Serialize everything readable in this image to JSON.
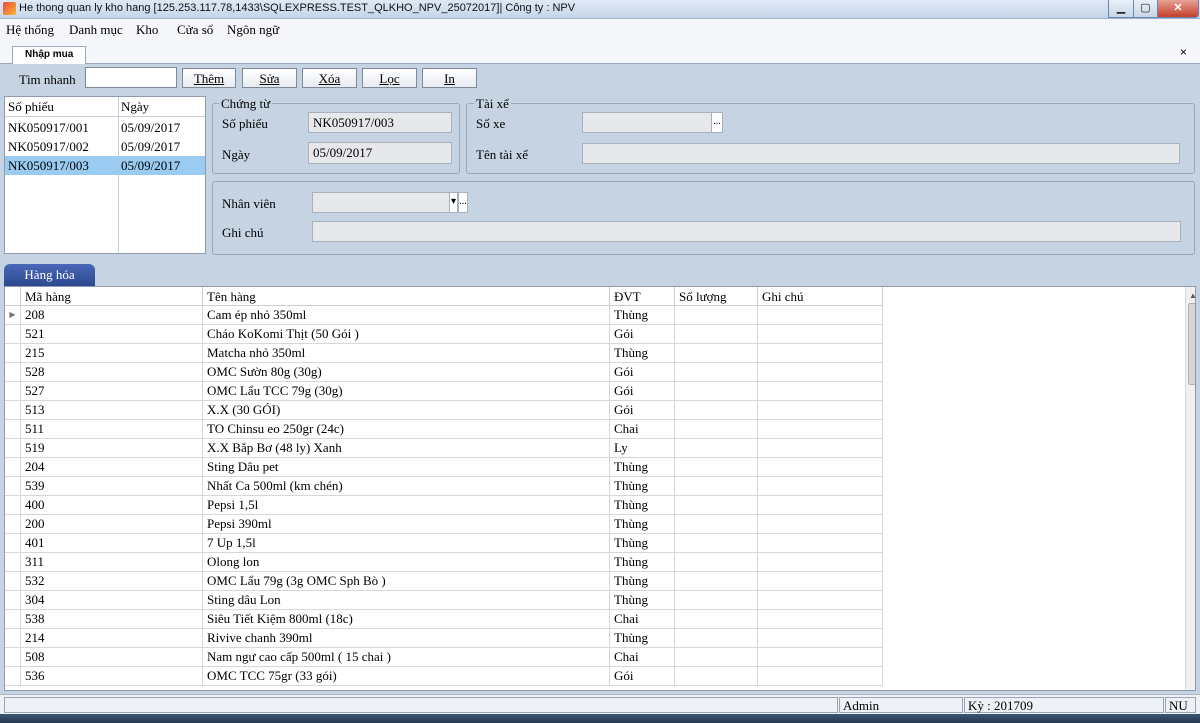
{
  "window": {
    "title": "He thong quan ly kho hang [125.253.117.78,1433\\SQLEXPRESS.TEST_QLKHO_NPV_25072017]| Công ty : NPV",
    "min": "▁",
    "max": "▢",
    "close": "✕"
  },
  "menu": [
    "Hệ thống",
    "Danh mục",
    "Kho",
    "Cửa sổ",
    "Ngôn ngữ"
  ],
  "tab": {
    "label": "Nhập mua",
    "close": "×"
  },
  "toolbar": {
    "search_label": "Tìm nhanh",
    "search_value": "",
    "buttons": [
      "Thêm",
      "Sửa",
      "Xóa",
      "Lọc",
      "In"
    ]
  },
  "doclist": {
    "headers": [
      "Số phiếu",
      "Ngày"
    ],
    "rows": [
      {
        "id": "NK050917/001",
        "date": "05/09/2017"
      },
      {
        "id": "NK050917/002",
        "date": "05/09/2017"
      },
      {
        "id": "NK050917/003",
        "date": "05/09/2017"
      }
    ],
    "selected_index": 2
  },
  "chungtu": {
    "group": "Chứng từ",
    "so_phieu_label": "Số phiếu",
    "so_phieu": "NK050917/003",
    "ngay_label": "Ngày",
    "ngay": "05/09/2017"
  },
  "taixe": {
    "group": "Tài xế",
    "so_xe_label": "Số xe",
    "so_xe": "",
    "ten_label": "Tên tài xế",
    "ten": "",
    "dots": "..."
  },
  "extra": {
    "nhanvien_label": "Nhân viên",
    "nhanvien": "",
    "ghichu_label": "Ghi chú",
    "ghichu": "",
    "dots": "..."
  },
  "goods": {
    "tab_label": "Hàng hóa",
    "columns": [
      "Mã hàng",
      "Tên hàng",
      "ĐVT",
      "Số lượng",
      "Ghi chú"
    ],
    "rows": [
      [
        "208",
        "Cam ép nhỏ 350ml",
        "Thùng"
      ],
      [
        "521",
        "Cháo KoKomi Thịt  (50 Gói )",
        "Gói"
      ],
      [
        "215",
        "Matcha nhỏ 350ml",
        "Thùng"
      ],
      [
        "528",
        "OMC Sườn 80g (30g)",
        "Gói"
      ],
      [
        "527",
        "OMC Lẩu TCC 79g (30g)",
        "Gói"
      ],
      [
        "513",
        "X.X (30 GÓI)",
        "Gói"
      ],
      [
        "511",
        "TO Chinsu eo 250gr (24c)",
        "Chai"
      ],
      [
        "519",
        "X.X  Bắp Bơ (48 ly) Xanh",
        "Ly"
      ],
      [
        "204",
        "Sting Dâu pet",
        "Thùng"
      ],
      [
        "539",
        "Nhất Ca 500ml (km chén)",
        "Thùng"
      ],
      [
        "400",
        "Pepsi 1,5l",
        "Thùng"
      ],
      [
        "200",
        "Pepsi 390ml",
        "Thùng"
      ],
      [
        "401",
        "7 Up 1,5l",
        "Thùng"
      ],
      [
        "311",
        "Olong lon",
        "Thùng"
      ],
      [
        "532",
        "OMC Lẩu 79g (3g OMC Sph Bò )",
        "Thùng"
      ],
      [
        "304",
        "Sting dâu Lon",
        "Thùng"
      ],
      [
        "538",
        "Siêu Tiết Kiệm 800ml (18c)",
        "Chai"
      ],
      [
        "214",
        "Rivive chanh 390ml",
        "Thùng"
      ],
      [
        "508",
        "Nam ngư cao cấp 500ml ( 15 chai )",
        "Chai"
      ],
      [
        "536",
        "OMC TCC 75gr (33 gói)",
        "Gói"
      ]
    ]
  },
  "status": {
    "user": "Admin",
    "period": "Kỳ : 201709",
    "mode": "NU"
  }
}
